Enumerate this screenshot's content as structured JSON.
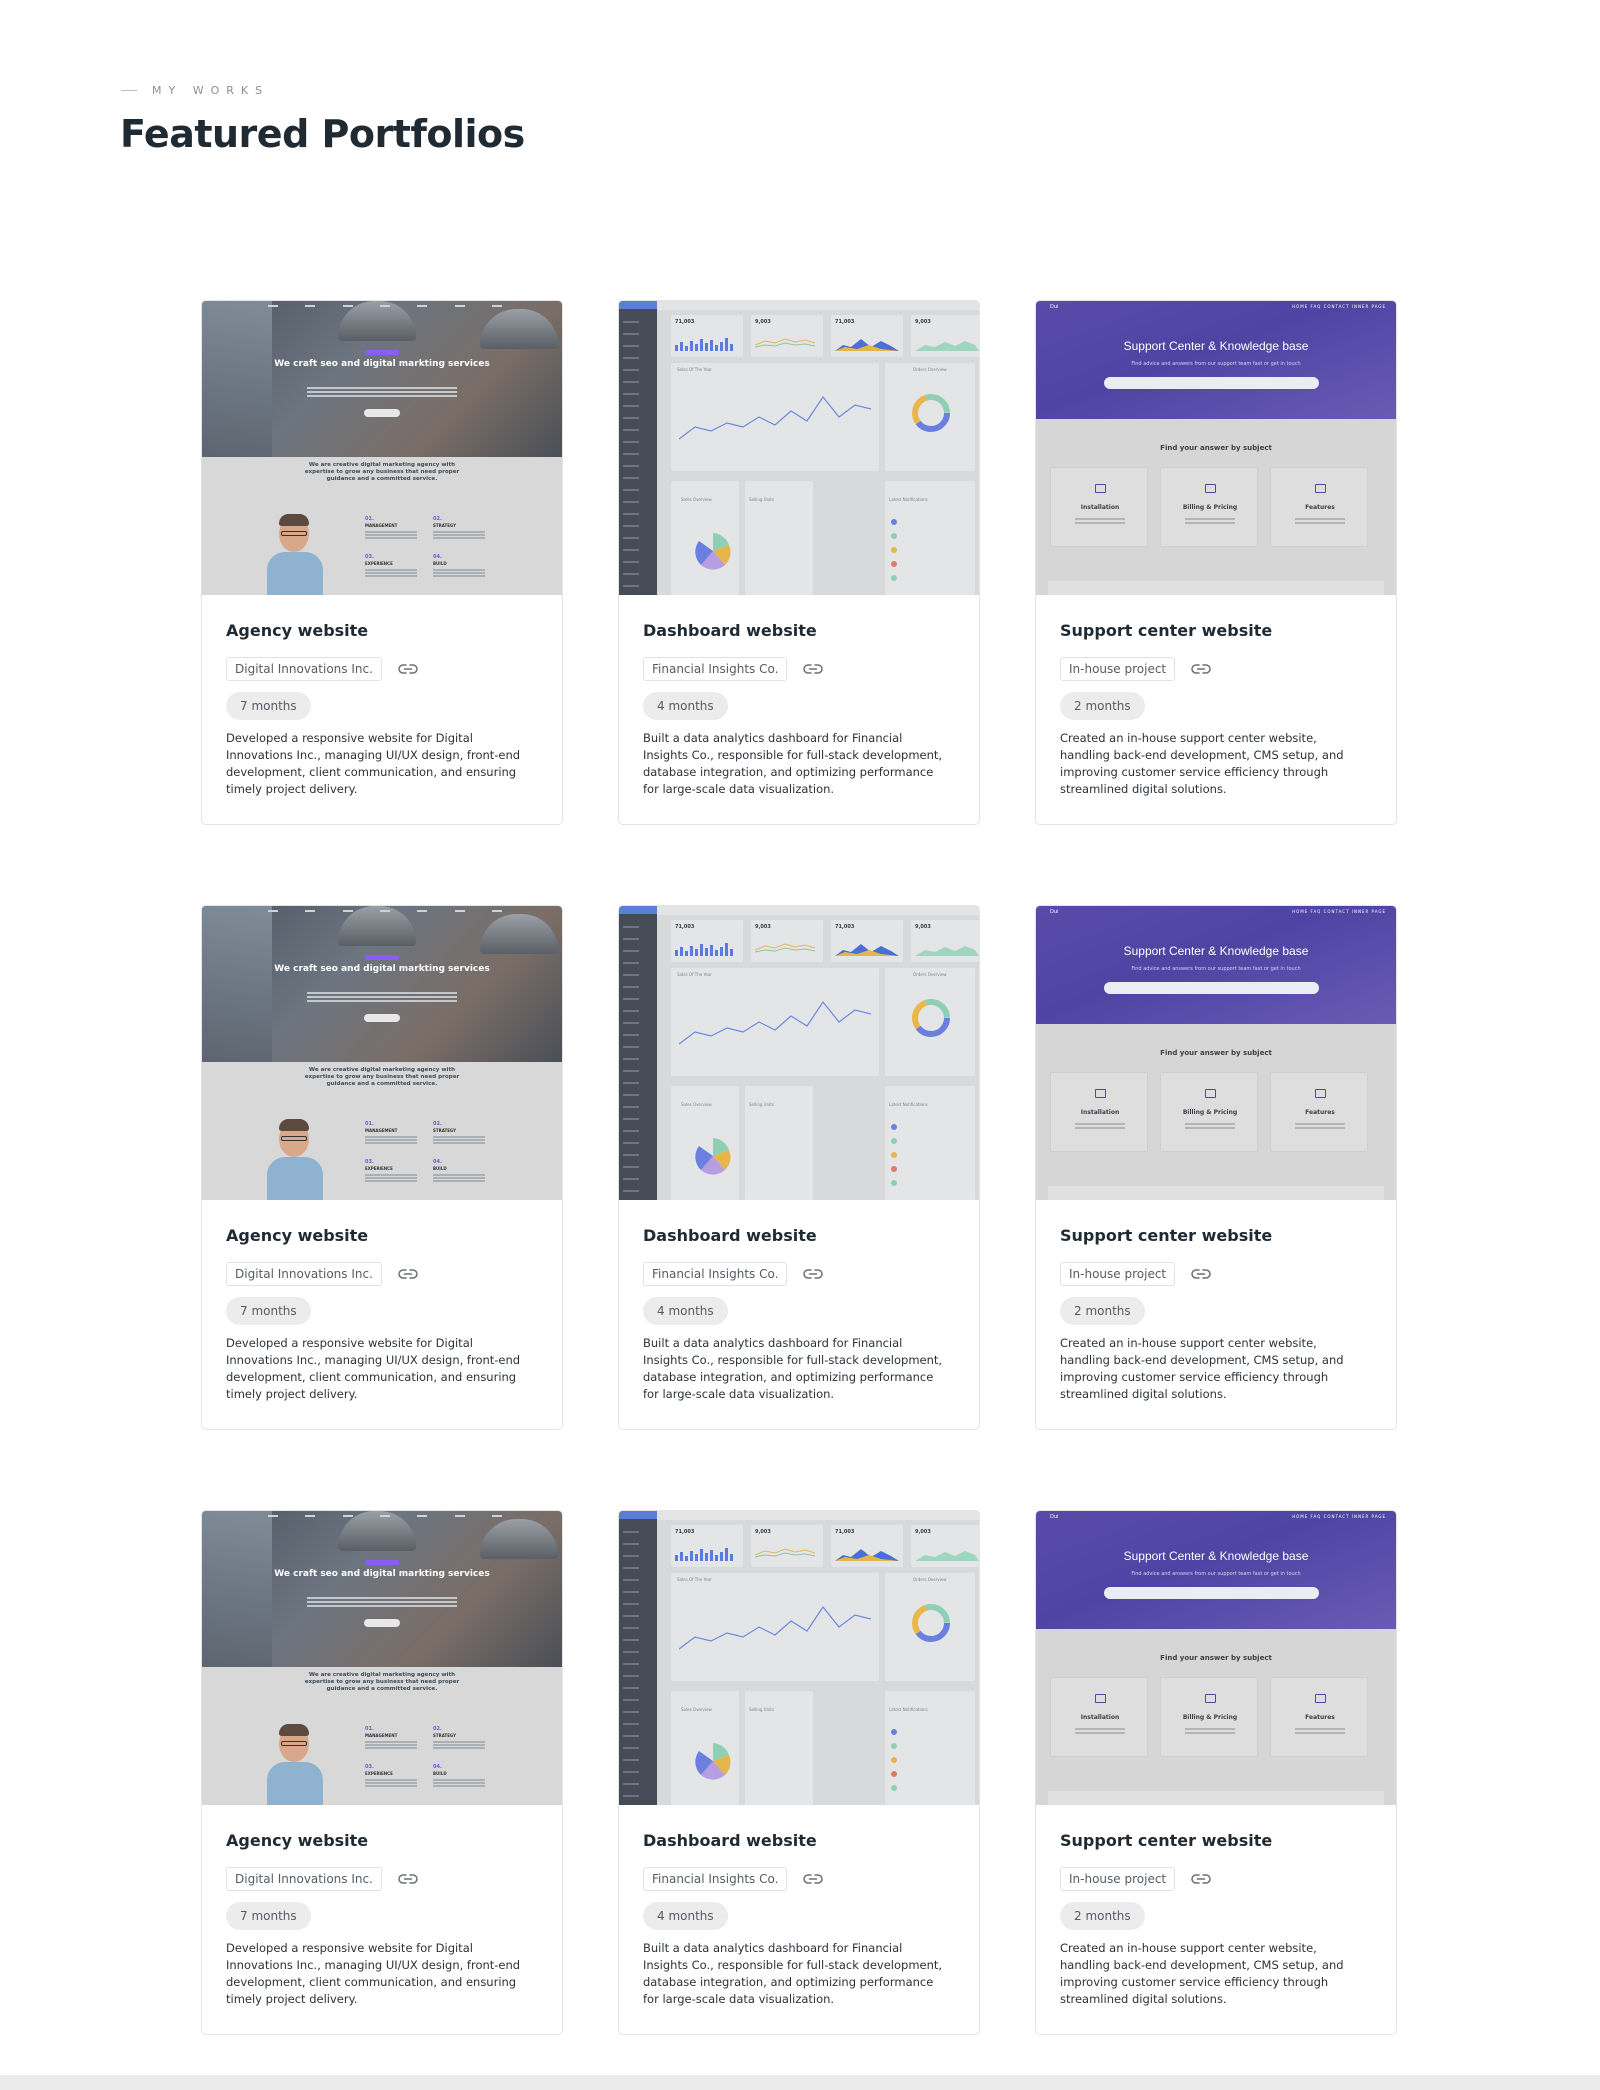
{
  "section": {
    "eyebrow": "MY WORKS",
    "title": "Featured Portfolios"
  },
  "portfolios": [
    {
      "type": "agency",
      "title": "Agency website",
      "client": "Digital Innovations Inc.",
      "duration": "7 months",
      "description": "Developed a responsive website for Digital Innovations Inc., managing UI/UX design, front-end development, client communication, and ensuring timely project delivery.",
      "preview": {
        "hero": "We craft seo and digital markting services",
        "tagline": "We are creative digital marketing agency with expertise to grow any business that need proper guidance and a committed service.",
        "items": [
          {
            "num": "01.",
            "label": "MANAGEMENT"
          },
          {
            "num": "02.",
            "label": "STRATEGY"
          },
          {
            "num": "03.",
            "label": "EXPERIENCE"
          },
          {
            "num": "04.",
            "label": "BUILD"
          }
        ]
      }
    },
    {
      "type": "dashboard",
      "title": "Dashboard website",
      "client": "Financial Insights Co.",
      "duration": "4 months",
      "description": "Built a data analytics dashboard for Financial Insights Co., responsible for full-stack development, database integration, and optimizing performance for large-scale data visualization.",
      "preview": {
        "stats": [
          "71,003",
          "9,003",
          "71,003",
          "9,003"
        ],
        "panel_sales": "Sales Of The Year",
        "panel_orders": "Orders Overview",
        "panel_overview": "Sales Overview",
        "panel_units": "Selling Units",
        "panel_notify": "Latest Notifications"
      }
    },
    {
      "type": "support",
      "title": "Support center website",
      "client": "In-house project",
      "duration": "2 months",
      "description": "Created an in-house support center website, handling back-end development, CMS setup, and improving customer service efficiency through streamlined digital solutions.",
      "preview": {
        "logo": "Dui",
        "nav": "HOME   FAQ   CONTACT   INNER PAGE",
        "hero": "Support Center & Knowledge base",
        "sub": "Find advice and answers from our support team fast or get in touch",
        "find": "Find your answer by subject",
        "tiles": [
          "Installation",
          "Billing & Pricing",
          "Features"
        ]
      }
    },
    {
      "type": "agency",
      "title": "Agency website",
      "client": "Digital Innovations Inc.",
      "duration": "7 months",
      "description": "Developed a responsive website for Digital Innovations Inc., managing UI/UX design, front-end development, client communication, and ensuring timely project delivery.",
      "preview": {
        "hero": "We craft seo and digital markting services",
        "tagline": "We are creative digital marketing agency with expertise to grow any business that need proper guidance and a committed service.",
        "items": [
          {
            "num": "01.",
            "label": "MANAGEMENT"
          },
          {
            "num": "02.",
            "label": "STRATEGY"
          },
          {
            "num": "03.",
            "label": "EXPERIENCE"
          },
          {
            "num": "04.",
            "label": "BUILD"
          }
        ]
      }
    },
    {
      "type": "dashboard",
      "title": "Dashboard website",
      "client": "Financial Insights Co.",
      "duration": "4 months",
      "description": "Built a data analytics dashboard for Financial Insights Co., responsible for full-stack development, database integration, and optimizing performance for large-scale data visualization.",
      "preview": {
        "stats": [
          "71,003",
          "9,003",
          "71,003",
          "9,003"
        ],
        "panel_sales": "Sales Of The Year",
        "panel_orders": "Orders Overview",
        "panel_overview": "Sales Overview",
        "panel_units": "Selling Units",
        "panel_notify": "Latest Notifications"
      }
    },
    {
      "type": "support",
      "title": "Support center website",
      "client": "In-house project",
      "duration": "2 months",
      "description": "Created an in-house support center website, handling back-end development, CMS setup, and improving customer service efficiency through streamlined digital solutions.",
      "preview": {
        "logo": "Dui",
        "nav": "HOME   FAQ   CONTACT   INNER PAGE",
        "hero": "Support Center & Knowledge base",
        "sub": "Find advice and answers from our support team fast or get in touch",
        "find": "Find your answer by subject",
        "tiles": [
          "Installation",
          "Billing & Pricing",
          "Features"
        ]
      }
    },
    {
      "type": "agency",
      "title": "Agency website",
      "client": "Digital Innovations Inc.",
      "duration": "7 months",
      "description": "Developed a responsive website for Digital Innovations Inc., managing UI/UX design, front-end development, client communication, and ensuring timely project delivery.",
      "preview": {
        "hero": "We craft seo and digital markting services",
        "tagline": "We are creative digital marketing agency with expertise to grow any business that need proper guidance and a committed service.",
        "items": [
          {
            "num": "01.",
            "label": "MANAGEMENT"
          },
          {
            "num": "02.",
            "label": "STRATEGY"
          },
          {
            "num": "03.",
            "label": "EXPERIENCE"
          },
          {
            "num": "04.",
            "label": "BUILD"
          }
        ]
      }
    },
    {
      "type": "dashboard",
      "title": "Dashboard website",
      "client": "Financial Insights Co.",
      "duration": "4 months",
      "description": "Built a data analytics dashboard for Financial Insights Co., responsible for full-stack development, database integration, and optimizing performance for large-scale data visualization.",
      "preview": {
        "stats": [
          "71,003",
          "9,003",
          "71,003",
          "9,003"
        ],
        "panel_sales": "Sales Of The Year",
        "panel_orders": "Orders Overview",
        "panel_overview": "Sales Overview",
        "panel_units": "Selling Units",
        "panel_notify": "Latest Notifications"
      }
    },
    {
      "type": "support",
      "title": "Support center website",
      "client": "In-house project",
      "duration": "2 months",
      "description": "Created an in-house support center website, handling back-end development, CMS setup, and improving customer service efficiency through streamlined digital solutions.",
      "preview": {
        "logo": "Dui",
        "nav": "HOME   FAQ   CONTACT   INNER PAGE",
        "hero": "Support Center & Knowledge base",
        "sub": "Find advice and answers from our support team fast or get in touch",
        "find": "Find your answer by subject",
        "tiles": [
          "Installation",
          "Billing & Pricing",
          "Features"
        ]
      }
    }
  ],
  "icons": {
    "link": "link-icon"
  },
  "colors": {
    "accent_purple": "#4f44a3",
    "dashboard_sidebar": "#454b57",
    "badge_bg": "#ececec"
  }
}
